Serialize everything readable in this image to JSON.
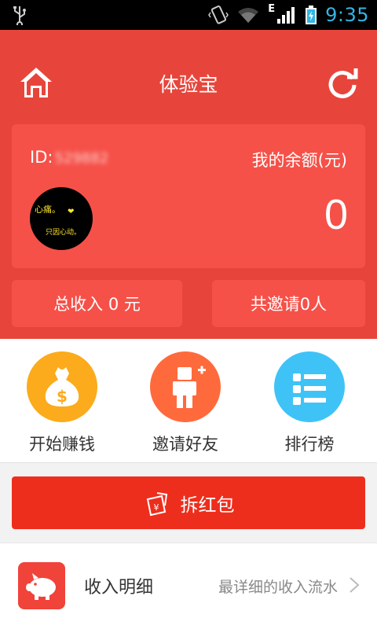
{
  "status_bar": {
    "network_type": "E",
    "time": "9:35"
  },
  "header": {
    "title": "体验宝"
  },
  "account": {
    "id_label": "ID:",
    "id_value": "529882",
    "balance_title": "我的余额(元)",
    "balance_value": "0",
    "avatar_text_line1": "心痛。",
    "avatar_text_line2": "只因心动。",
    "avatar_heart": "❤"
  },
  "stats": {
    "total_income": "总收入 0 元",
    "total_invites": "共邀请0人"
  },
  "actions": [
    {
      "label": "开始赚钱",
      "color": "#fbab1b",
      "icon": "money-bag-icon"
    },
    {
      "label": "邀请好友",
      "color": "#ff6a3c",
      "icon": "invite-person-icon"
    },
    {
      "label": "排行榜",
      "color": "#3fc3f7",
      "icon": "list-icon"
    }
  ],
  "red_packet": {
    "label": "拆红包"
  },
  "income_detail": {
    "label": "收入明细",
    "description": "最详细的收入流水"
  },
  "colors": {
    "header_red": "#e7453b",
    "card_red": "#f55149",
    "button_red": "#ee2e1d",
    "time_blue": "#33b5e5"
  }
}
